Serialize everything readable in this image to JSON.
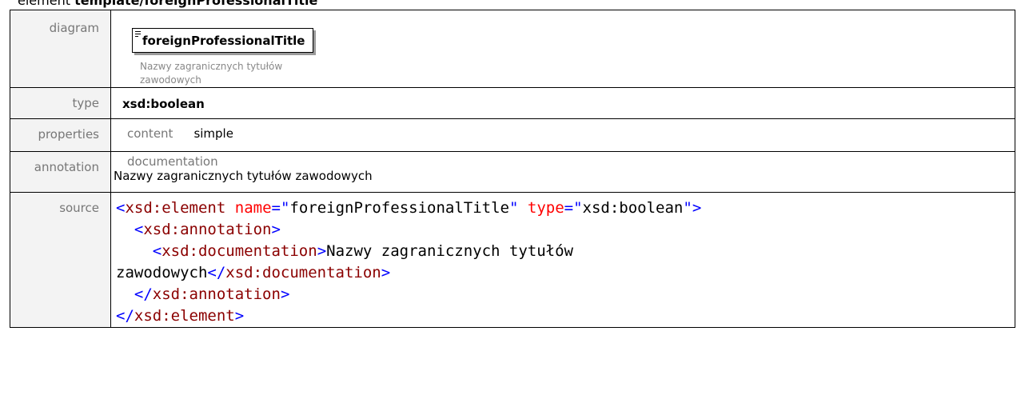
{
  "heading": {
    "kind": "element",
    "name": "template/foreignProfessionalTitle"
  },
  "rows": {
    "diagram": {
      "label": "diagram",
      "element_name": "foreignProfessionalTitle",
      "documentation": "Nazwy zagranicznych tytułów zawodowych"
    },
    "type": {
      "label": "type",
      "value": "xsd:boolean"
    },
    "properties": {
      "label": "properties",
      "key": "content",
      "value": "simple"
    },
    "annotation": {
      "label": "annotation",
      "key": "documentation",
      "value": "Nazwy zagranicznych tytułów zawodowych"
    },
    "source": {
      "label": "source",
      "lt": "<",
      "gt": ">",
      "lt_slash": "</",
      "quote": "\"",
      "eq": "=",
      "tag_element": "xsd:element",
      "attr_name": "name",
      "name_value": "foreignProfessionalTitle",
      "attr_type": "type",
      "type_value": "xsd:boolean",
      "tag_annotation": "xsd:annotation",
      "tag_documentation": "xsd:documentation",
      "doc_text_1": "Nazwy zagranicznych tytułów",
      "doc_text_2": "zawodowych"
    }
  },
  "colors": {
    "tag_bracket": "#0000ff",
    "tag_name": "#8b0000",
    "attr_name": "#ff0000",
    "label_bg": "#f3f3f3",
    "label_text": "#777777"
  }
}
